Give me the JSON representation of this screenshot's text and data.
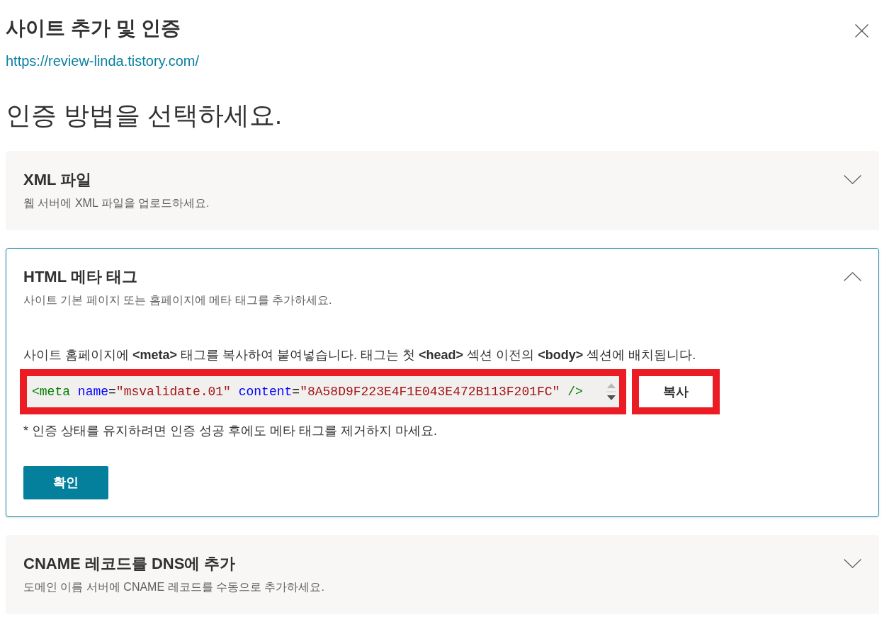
{
  "dialog": {
    "title": "사이트 추가 및 인증",
    "url": "https://review-linda.tistory.com/"
  },
  "heading": "인증 방법을 선택하세요.",
  "methods": [
    {
      "title": "XML 파일",
      "description": "웹 서버에 XML 파일을 업로드하세요.",
      "expanded": false
    },
    {
      "title": "HTML 메타 태그",
      "description": "사이트 기본 페이지 또는 홈페이지에 메타 태그를 추가하세요.",
      "expanded": true,
      "content": {
        "instruction": "사이트 홈페이지에 **<meta>** 태그를 복사하여 붙여넣습니다. 태그는 첫 **<head>** 섹션 이전의 **<body>** 섹션에 배치됩니다.",
        "code": {
          "highlighted": true,
          "tokens": [
            {
              "kind": "tag",
              "text": "<meta"
            },
            {
              "kind": "attr",
              "text": "name"
            },
            {
              "kind": "punct",
              "text": "="
            },
            {
              "kind": "value",
              "text": "\"msvalidate.01\""
            },
            {
              "kind": "attr",
              "text": "content"
            },
            {
              "kind": "punct",
              "text": "="
            },
            {
              "kind": "value",
              "text": "\"8A58D9F223E4F1E043E472B113F201FC\""
            },
            {
              "kind": "tag",
              "text": "/>"
            }
          ]
        },
        "copy_button": {
          "label": "복사",
          "highlighted": true
        },
        "note": "* 인증 상태를 유지하려면 인증 성공 후에도 메타 태그를 제거하지 마세요.",
        "confirm_button": "확인"
      }
    },
    {
      "title": "CNAME 레코드를 DNS에 추가",
      "description": "도메인 이름 서버에 CNAME 레코드를 수동으로 추가하세요.",
      "expanded": false
    }
  ]
}
